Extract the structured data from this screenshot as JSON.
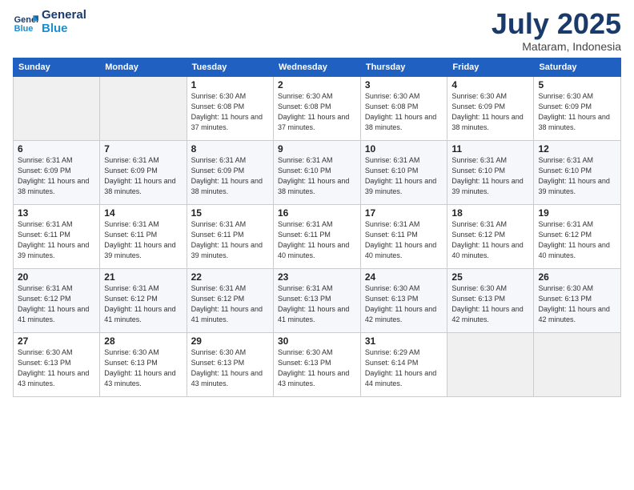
{
  "logo": {
    "line1": "General",
    "line2": "Blue"
  },
  "title": "July 2025",
  "location": "Mataram, Indonesia",
  "days_header": [
    "Sunday",
    "Monday",
    "Tuesday",
    "Wednesday",
    "Thursday",
    "Friday",
    "Saturday"
  ],
  "weeks": [
    [
      {
        "day": "",
        "info": ""
      },
      {
        "day": "",
        "info": ""
      },
      {
        "day": "1",
        "info": "Sunrise: 6:30 AM\nSunset: 6:08 PM\nDaylight: 11 hours and 37 minutes."
      },
      {
        "day": "2",
        "info": "Sunrise: 6:30 AM\nSunset: 6:08 PM\nDaylight: 11 hours and 37 minutes."
      },
      {
        "day": "3",
        "info": "Sunrise: 6:30 AM\nSunset: 6:08 PM\nDaylight: 11 hours and 38 minutes."
      },
      {
        "day": "4",
        "info": "Sunrise: 6:30 AM\nSunset: 6:09 PM\nDaylight: 11 hours and 38 minutes."
      },
      {
        "day": "5",
        "info": "Sunrise: 6:30 AM\nSunset: 6:09 PM\nDaylight: 11 hours and 38 minutes."
      }
    ],
    [
      {
        "day": "6",
        "info": "Sunrise: 6:31 AM\nSunset: 6:09 PM\nDaylight: 11 hours and 38 minutes."
      },
      {
        "day": "7",
        "info": "Sunrise: 6:31 AM\nSunset: 6:09 PM\nDaylight: 11 hours and 38 minutes."
      },
      {
        "day": "8",
        "info": "Sunrise: 6:31 AM\nSunset: 6:09 PM\nDaylight: 11 hours and 38 minutes."
      },
      {
        "day": "9",
        "info": "Sunrise: 6:31 AM\nSunset: 6:10 PM\nDaylight: 11 hours and 38 minutes."
      },
      {
        "day": "10",
        "info": "Sunrise: 6:31 AM\nSunset: 6:10 PM\nDaylight: 11 hours and 39 minutes."
      },
      {
        "day": "11",
        "info": "Sunrise: 6:31 AM\nSunset: 6:10 PM\nDaylight: 11 hours and 39 minutes."
      },
      {
        "day": "12",
        "info": "Sunrise: 6:31 AM\nSunset: 6:10 PM\nDaylight: 11 hours and 39 minutes."
      }
    ],
    [
      {
        "day": "13",
        "info": "Sunrise: 6:31 AM\nSunset: 6:11 PM\nDaylight: 11 hours and 39 minutes."
      },
      {
        "day": "14",
        "info": "Sunrise: 6:31 AM\nSunset: 6:11 PM\nDaylight: 11 hours and 39 minutes."
      },
      {
        "day": "15",
        "info": "Sunrise: 6:31 AM\nSunset: 6:11 PM\nDaylight: 11 hours and 39 minutes."
      },
      {
        "day": "16",
        "info": "Sunrise: 6:31 AM\nSunset: 6:11 PM\nDaylight: 11 hours and 40 minutes."
      },
      {
        "day": "17",
        "info": "Sunrise: 6:31 AM\nSunset: 6:11 PM\nDaylight: 11 hours and 40 minutes."
      },
      {
        "day": "18",
        "info": "Sunrise: 6:31 AM\nSunset: 6:12 PM\nDaylight: 11 hours and 40 minutes."
      },
      {
        "day": "19",
        "info": "Sunrise: 6:31 AM\nSunset: 6:12 PM\nDaylight: 11 hours and 40 minutes."
      }
    ],
    [
      {
        "day": "20",
        "info": "Sunrise: 6:31 AM\nSunset: 6:12 PM\nDaylight: 11 hours and 41 minutes."
      },
      {
        "day": "21",
        "info": "Sunrise: 6:31 AM\nSunset: 6:12 PM\nDaylight: 11 hours and 41 minutes."
      },
      {
        "day": "22",
        "info": "Sunrise: 6:31 AM\nSunset: 6:12 PM\nDaylight: 11 hours and 41 minutes."
      },
      {
        "day": "23",
        "info": "Sunrise: 6:31 AM\nSunset: 6:13 PM\nDaylight: 11 hours and 41 minutes."
      },
      {
        "day": "24",
        "info": "Sunrise: 6:30 AM\nSunset: 6:13 PM\nDaylight: 11 hours and 42 minutes."
      },
      {
        "day": "25",
        "info": "Sunrise: 6:30 AM\nSunset: 6:13 PM\nDaylight: 11 hours and 42 minutes."
      },
      {
        "day": "26",
        "info": "Sunrise: 6:30 AM\nSunset: 6:13 PM\nDaylight: 11 hours and 42 minutes."
      }
    ],
    [
      {
        "day": "27",
        "info": "Sunrise: 6:30 AM\nSunset: 6:13 PM\nDaylight: 11 hours and 43 minutes."
      },
      {
        "day": "28",
        "info": "Sunrise: 6:30 AM\nSunset: 6:13 PM\nDaylight: 11 hours and 43 minutes."
      },
      {
        "day": "29",
        "info": "Sunrise: 6:30 AM\nSunset: 6:13 PM\nDaylight: 11 hours and 43 minutes."
      },
      {
        "day": "30",
        "info": "Sunrise: 6:30 AM\nSunset: 6:13 PM\nDaylight: 11 hours and 43 minutes."
      },
      {
        "day": "31",
        "info": "Sunrise: 6:29 AM\nSunset: 6:14 PM\nDaylight: 11 hours and 44 minutes."
      },
      {
        "day": "",
        "info": ""
      },
      {
        "day": "",
        "info": ""
      }
    ]
  ]
}
